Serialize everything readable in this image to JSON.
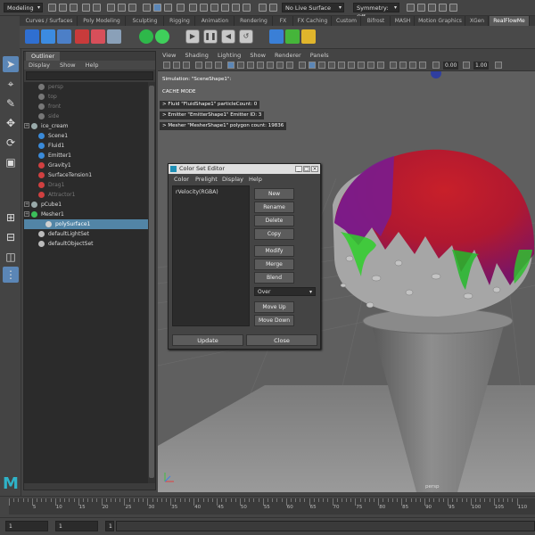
{
  "status": {
    "menu_set": "Modeling",
    "live_surface": "No Live Surface",
    "symmetry": "Symmetry: Off"
  },
  "shelf_tabs": [
    {
      "label": "Curves / Surfaces",
      "w": 63
    },
    {
      "label": "Poly Modeling",
      "w": 53
    },
    {
      "label": "Sculpting",
      "w": 42
    },
    {
      "label": "Rigging",
      "w": 34
    },
    {
      "label": "Animation",
      "w": 43
    },
    {
      "label": "Rendering",
      "w": 42
    },
    {
      "label": "FX",
      "w": 22
    },
    {
      "label": "FX Caching",
      "w": 42
    },
    {
      "label": "Custom",
      "w": 32
    },
    {
      "label": "Bifrost",
      "w": 32
    },
    {
      "label": "MASH",
      "w": 26
    },
    {
      "label": "Motion Graphics",
      "w": 56
    },
    {
      "label": "XGen",
      "w": 25
    },
    {
      "label": "RealFlowMe",
      "w": 45
    }
  ],
  "outliner": {
    "tab": "Outliner",
    "menu": [
      "Display",
      "Show",
      "Help"
    ],
    "items": [
      {
        "label": "persp",
        "indent": 1,
        "icon": "#777",
        "dim": true
      },
      {
        "label": "top",
        "indent": 1,
        "icon": "#777",
        "dim": true
      },
      {
        "label": "front",
        "indent": 1,
        "icon": "#777",
        "dim": true
      },
      {
        "label": "side",
        "indent": 1,
        "icon": "#777",
        "dim": true
      },
      {
        "label": "ice_cream",
        "indent": 0,
        "icon": "#9aa",
        "expand": true
      },
      {
        "label": "Scene1",
        "indent": 1,
        "icon": "#3a8ad8"
      },
      {
        "label": "Fluid1",
        "indent": 1,
        "icon": "#3a8ad8"
      },
      {
        "label": "Emitter1",
        "indent": 1,
        "icon": "#3a8ad8"
      },
      {
        "label": "Gravity1",
        "indent": 1,
        "icon": "#d04040"
      },
      {
        "label": "SurfaceTension1",
        "indent": 1,
        "icon": "#d04040"
      },
      {
        "label": "Drag1",
        "indent": 1,
        "icon": "#d04040",
        "dim": true
      },
      {
        "label": "Attractor1",
        "indent": 1,
        "icon": "#d04040",
        "dim": true
      },
      {
        "label": "pCube1",
        "indent": 0,
        "icon": "#9aa",
        "expand": true
      },
      {
        "label": "Mesher1",
        "indent": 0,
        "icon": "#3bbf5a",
        "expand": true
      },
      {
        "label": "polySurface1",
        "indent": 2,
        "icon": "#d0d0d0",
        "selected": true
      },
      {
        "label": "defaultLightSet",
        "indent": 1,
        "icon": "#bbb"
      },
      {
        "label": "defaultObjectSet",
        "indent": 1,
        "icon": "#bbb"
      }
    ]
  },
  "viewport": {
    "menu": [
      "View",
      "Shading",
      "Lighting",
      "Show",
      "Renderer",
      "Panels"
    ],
    "field1": "0.00",
    "field2": "1.00",
    "hud": {
      "sim": "Simulation: \"SceneShape1\":",
      "cache": "CACHE MODE",
      "fluid": "> Fluid \"FluidShape1\" particleCount: 0",
      "emitter": "> Emitter \"EmitterShape1\" Emitter ID: 3",
      "mesher": "> Mesher \"MesherShape1\" polygon count: 19836"
    },
    "camera": "persp"
  },
  "color_set_editor": {
    "title": "Color Set Editor",
    "menu": [
      "Color",
      "Prelight",
      "Display",
      "Help"
    ],
    "color_set": "rVelocity(RGBA)",
    "buttons": [
      "New",
      "Rename",
      "Delete",
      "Copy",
      "Modify",
      "Merge",
      "Blend",
      "Move Up",
      "Move Down"
    ],
    "blend_mode": "Over",
    "update": "Update",
    "close": "Close"
  },
  "timeline": {
    "ticks": [
      "5",
      "10",
      "15",
      "20",
      "25",
      "30",
      "35",
      "40",
      "45",
      "50",
      "55",
      "60",
      "65",
      "70",
      "75",
      "80",
      "85",
      "90",
      "95",
      "100",
      "105",
      "110"
    ],
    "start": "1",
    "current": "1",
    "range_start": "1"
  },
  "colors": {
    "accent": "#5285a6",
    "panel": "#444444",
    "viewport_bg": "#5f5f5f"
  }
}
